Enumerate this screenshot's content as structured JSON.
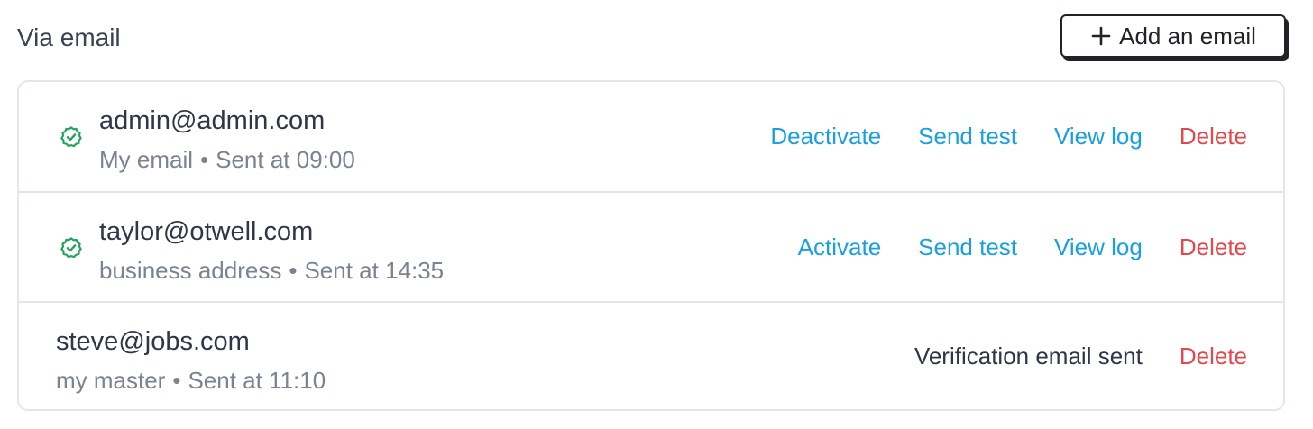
{
  "section": {
    "title": "Via email",
    "add_button_label": "Add an email"
  },
  "colors": {
    "link": "#1a9fe0",
    "danger": "#e4484f",
    "verified": "#22a35a"
  },
  "emails": [
    {
      "address": "admin@admin.com",
      "label": "My email",
      "separator": "•",
      "sent": "Sent at 09:00",
      "verified_icon": "verified-badge-icon",
      "actions": {
        "toggle": "Deactivate",
        "send_test": "Send test",
        "view_log": "View log",
        "delete": "Delete"
      }
    },
    {
      "address": "taylor@otwell.com",
      "label": "business address",
      "separator": "•",
      "sent": "Sent at 14:35",
      "verified_icon": "verified-badge-icon",
      "actions": {
        "toggle": "Activate",
        "send_test": "Send test",
        "view_log": "View log",
        "delete": "Delete"
      }
    },
    {
      "address": "steve@jobs.com",
      "label": "my master",
      "separator": "•",
      "sent": "Sent at 11:10",
      "status": "Verification email sent",
      "actions": {
        "delete": "Delete"
      }
    }
  ]
}
